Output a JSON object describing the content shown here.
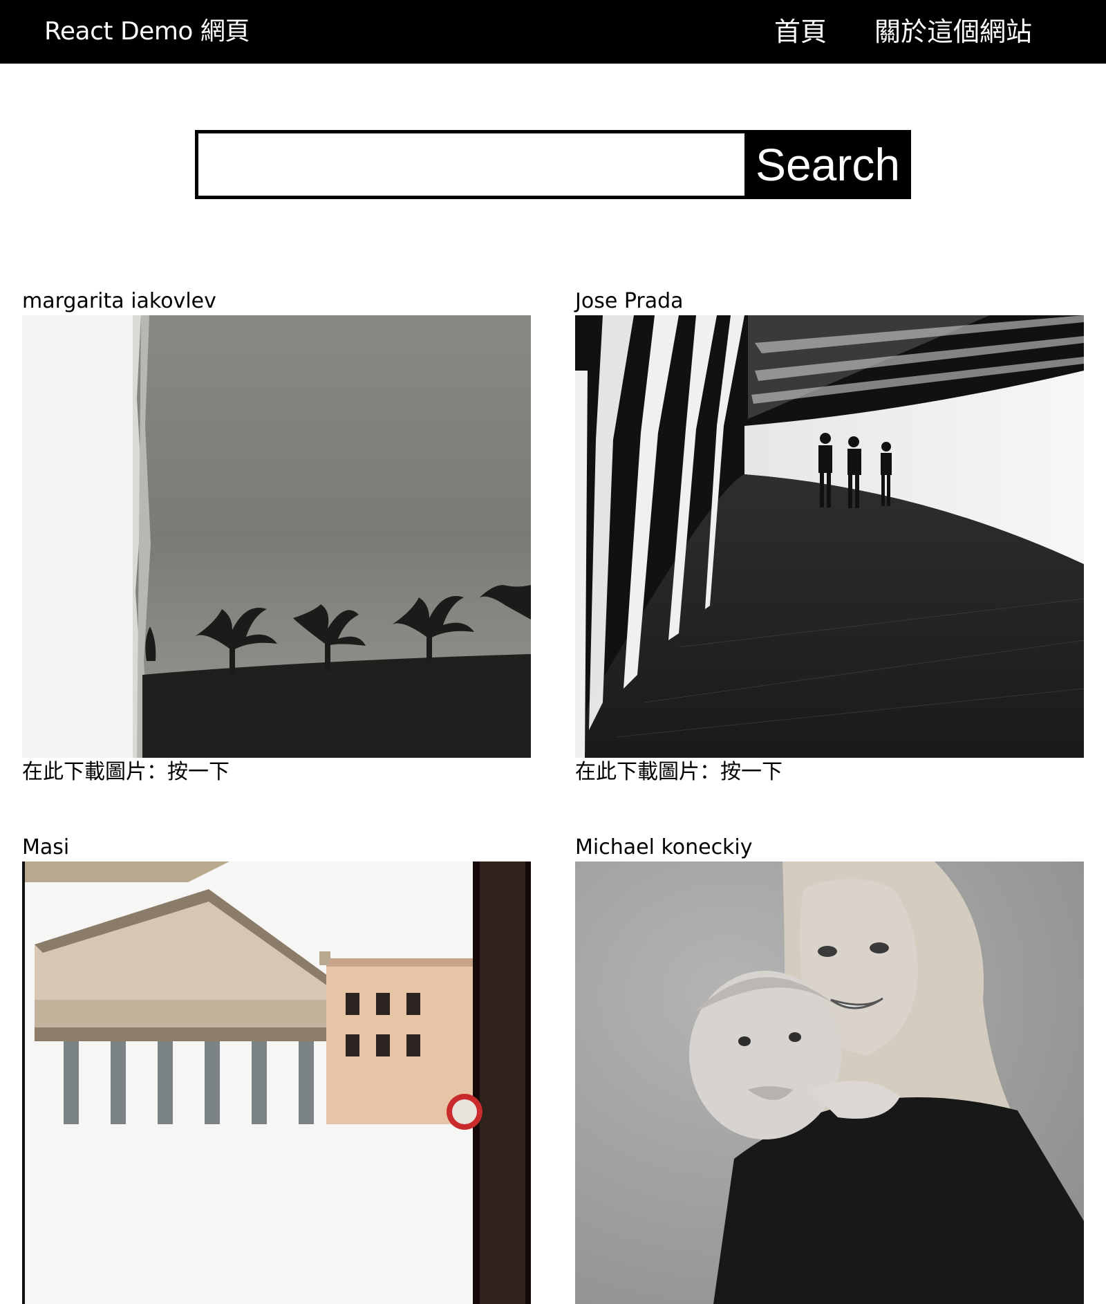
{
  "navbar": {
    "brand": "React Demo 網頁",
    "links": [
      {
        "label": "首頁"
      },
      {
        "label": "關於這個網站"
      }
    ]
  },
  "search": {
    "value": "",
    "placeholder": "",
    "button_label": "Search"
  },
  "photos": [
    {
      "author": "margarita iakovlev",
      "download_text": "在此下載圖片：按一下"
    },
    {
      "author": "Jose Prada",
      "download_text": "在此下載圖片：按一下"
    },
    {
      "author": "Masi"
    },
    {
      "author": "Michael koneckiy"
    }
  ]
}
